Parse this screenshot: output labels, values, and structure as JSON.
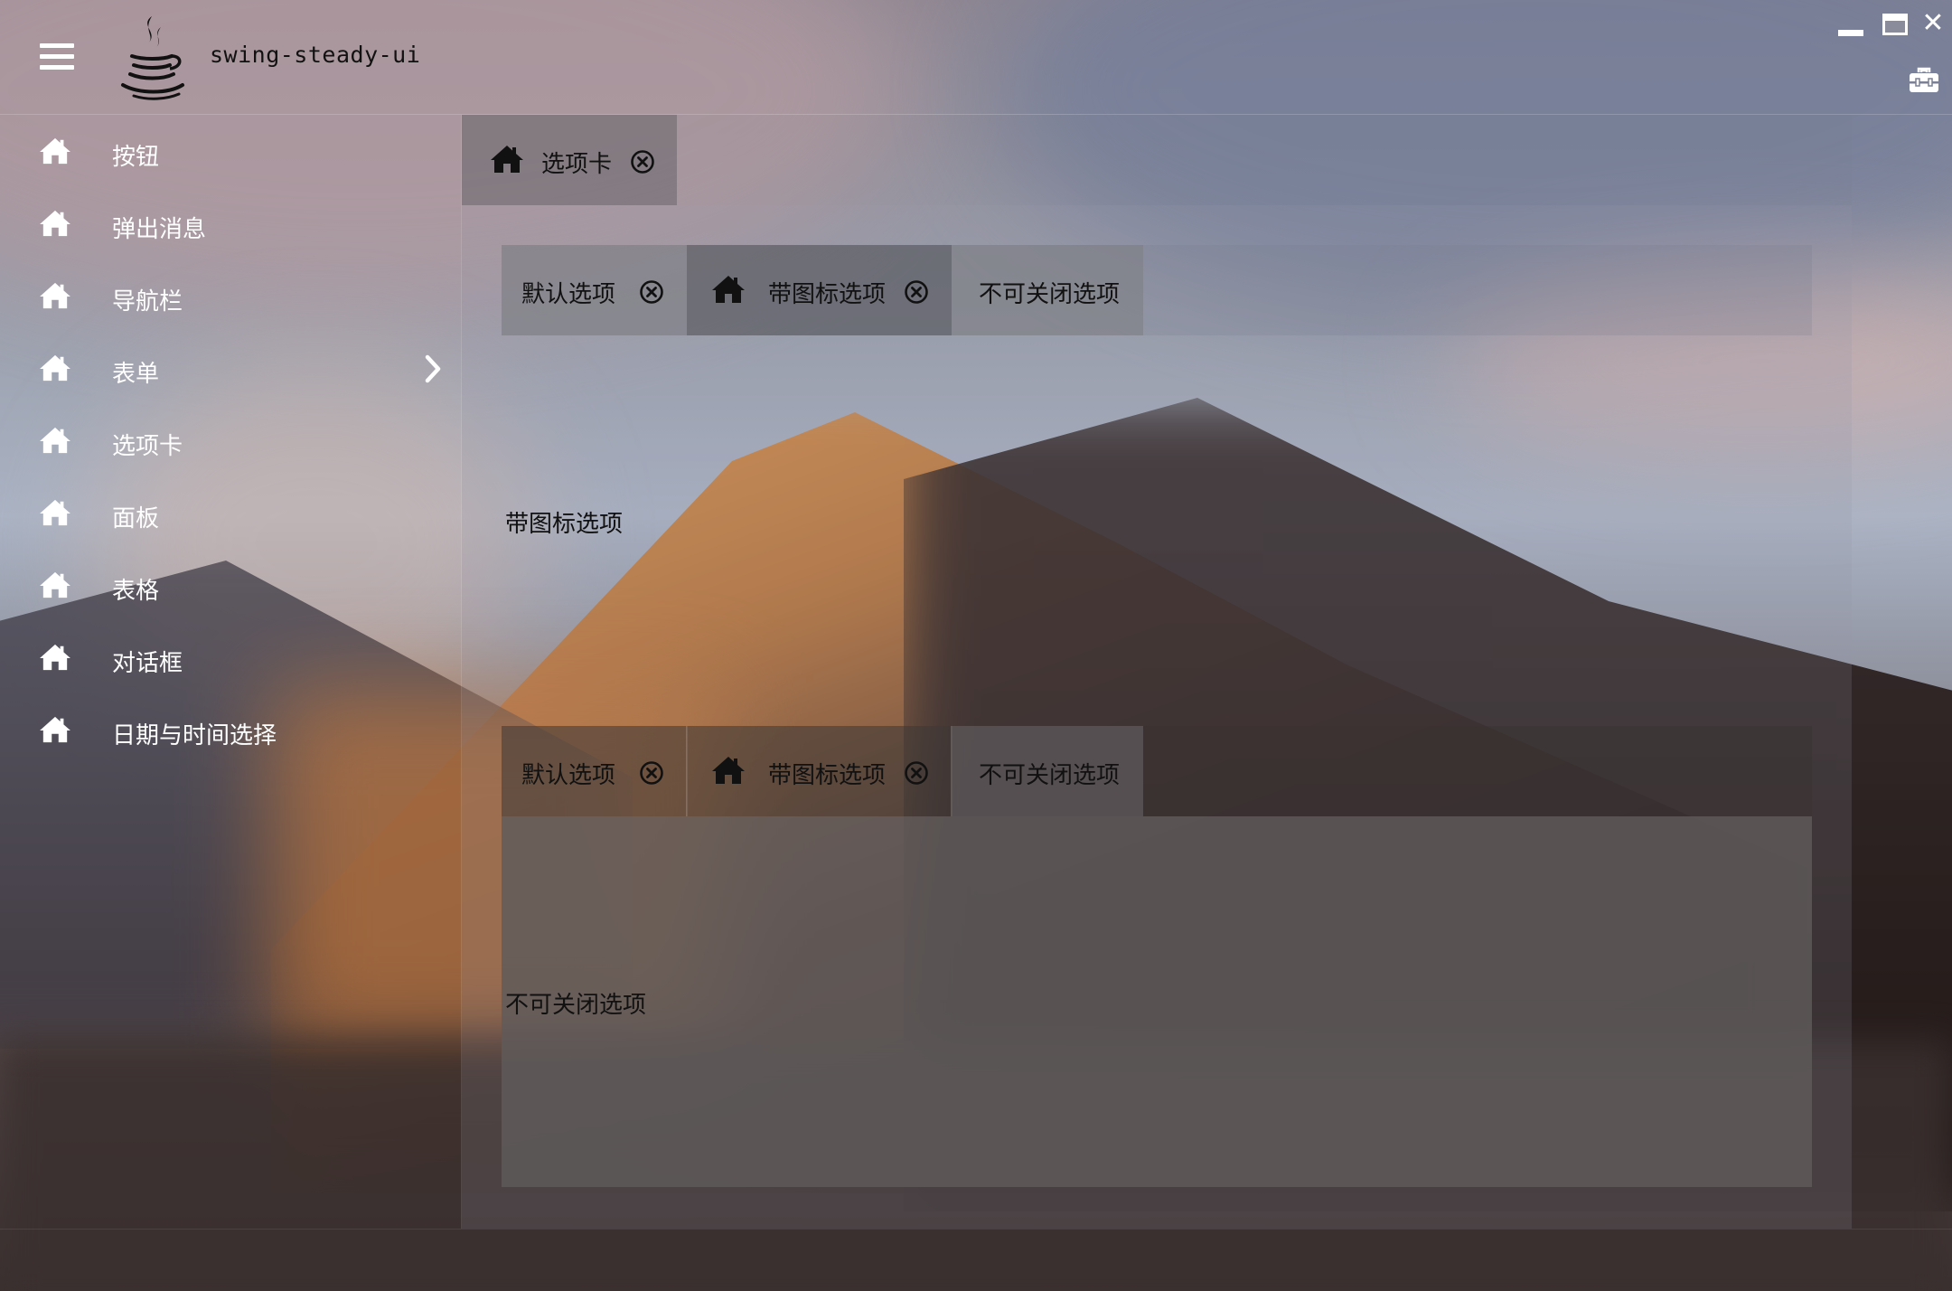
{
  "app": {
    "title": "swing-steady-ui"
  },
  "window_controls": [
    "minimize-icon",
    "maximize-icon",
    "close-icon"
  ],
  "sidebar": {
    "items": [
      {
        "label": "按钮",
        "icon": "home-icon"
      },
      {
        "label": "弹出消息",
        "icon": "home-icon"
      },
      {
        "label": "导航栏",
        "icon": "home-icon"
      },
      {
        "label": "表单",
        "icon": "home-icon",
        "has_submenu": true
      },
      {
        "label": "选项卡",
        "icon": "home-icon"
      },
      {
        "label": "面板",
        "icon": "home-icon"
      },
      {
        "label": "表格",
        "icon": "home-icon"
      },
      {
        "label": "对话框",
        "icon": "home-icon"
      },
      {
        "label": "日期与时间选择",
        "icon": "home-icon"
      }
    ]
  },
  "content": {
    "outer_tab": {
      "label": "选项卡",
      "icon": "home-icon",
      "closable": true
    },
    "tabset_1": {
      "tabs": [
        {
          "label": "默认选项",
          "closable": true
        },
        {
          "label": "带图标选项",
          "icon": "home-icon",
          "closable": true,
          "selected": true
        },
        {
          "label": "不可关闭选项",
          "closable": false
        }
      ],
      "panel_text": "带图标选项"
    },
    "tabset_2": {
      "tabs": [
        {
          "label": "默认选项",
          "closable": true
        },
        {
          "label": "带图标选项",
          "icon": "home-icon",
          "closable": true
        },
        {
          "label": "不可关闭选项",
          "closable": false,
          "selected": true
        }
      ],
      "panel_text": "不可关闭选项"
    }
  }
}
